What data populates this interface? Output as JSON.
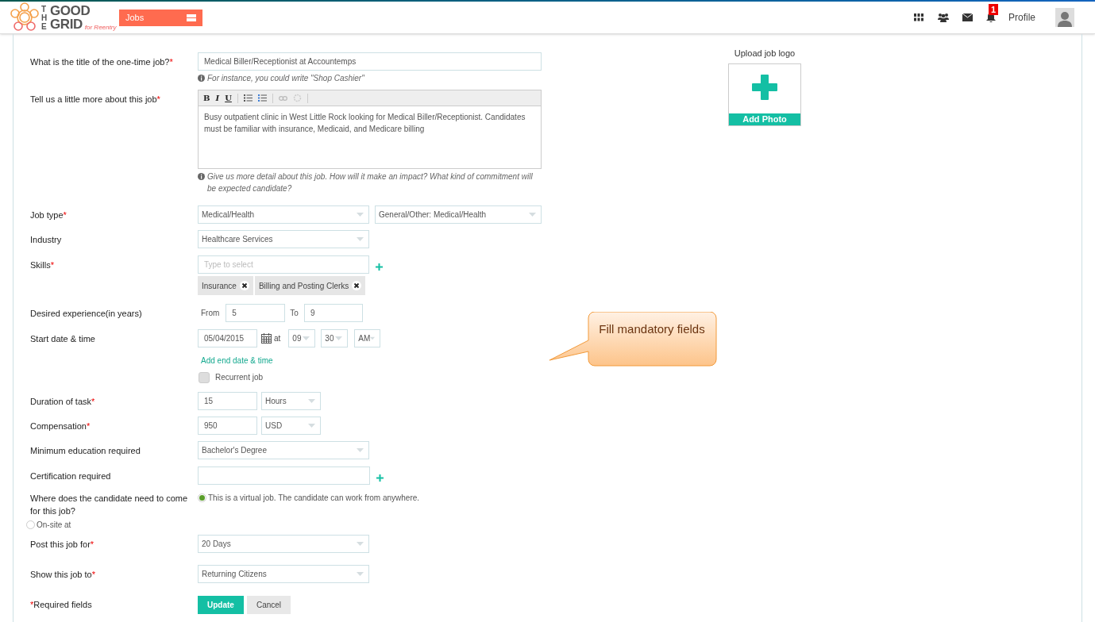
{
  "header": {
    "logo": {
      "small": "THE",
      "line1": "GOOD",
      "line2": "GRID",
      "tagline": "for Reentry"
    },
    "nav_button": "Jobs",
    "notification_count": "1",
    "profile_label": "Profile"
  },
  "form": {
    "title": {
      "label": "What is the title of the one-time job?",
      "mark": "*",
      "value": "Medical Biller/Receptionist at Accountemps",
      "hint": "For instance, you could write \"Shop Cashier\""
    },
    "description": {
      "label": "Tell us a little more about this job",
      "mark": "*",
      "toolbar": [
        "B",
        "I",
        "U"
      ],
      "value": "Busy outpatient clinic in West Little Rock looking for Medical Biller/Receptionist. Candidates must be familiar with insurance, Medicaid, and Medicare billing",
      "hint": "Give us more detail about this job. How will it make an impact? What kind of commitment will be expected candidate?"
    },
    "job_type": {
      "label": "Job type",
      "mark": "*",
      "values": [
        "Medical/Health",
        "General/Other: Medical/Health"
      ]
    },
    "industry": {
      "label": "Industry",
      "value": "Healthcare Services"
    },
    "skills": {
      "label": "Skills",
      "mark": "*",
      "placeholder": "Type to select",
      "tags": [
        "Insurance",
        "Billing and Posting Clerks"
      ]
    },
    "experience": {
      "label": "Desired experience(in years)",
      "from_label": "From",
      "from": "5",
      "to_label": "To",
      "to": "9"
    },
    "start": {
      "label": "Start date & time",
      "date": "05/04/2015",
      "at_label": "at",
      "hour": "09",
      "minute": "30",
      "period": "AM",
      "add_end_link": "Add end date & time",
      "recurrent": {
        "label": "Recurrent job",
        "checked": false
      }
    },
    "duration": {
      "label": "Duration of task",
      "mark": "*",
      "value": "15",
      "unit": "Hours"
    },
    "compensation": {
      "label": "Compensation",
      "mark": "*",
      "value": "950",
      "unit": "USD"
    },
    "education": {
      "label": "Minimum education required",
      "value": "Bachelor's Degree"
    },
    "certification": {
      "label": "Certification required"
    },
    "location": {
      "label": "Where does the candidate need to come for this job?",
      "options": [
        {
          "label": "This is a virtual job. The candidate can work from anywhere.",
          "selected": true
        },
        {
          "label": "On-site at",
          "selected": false
        }
      ]
    },
    "post_for": {
      "label": "Post this job for",
      "mark": "*",
      "value": "20 Days"
    },
    "show_to": {
      "label": "Show this job to",
      "mark": "*",
      "value": "Returning Citizens"
    },
    "required_note": {
      "mark": "*",
      "text": "Required fields"
    },
    "buttons": [
      "Update",
      "Cancel"
    ]
  },
  "upload": {
    "title": "Upload job logo",
    "button": "Add Photo"
  },
  "callout": {
    "text": "Fill mandatory fields"
  }
}
